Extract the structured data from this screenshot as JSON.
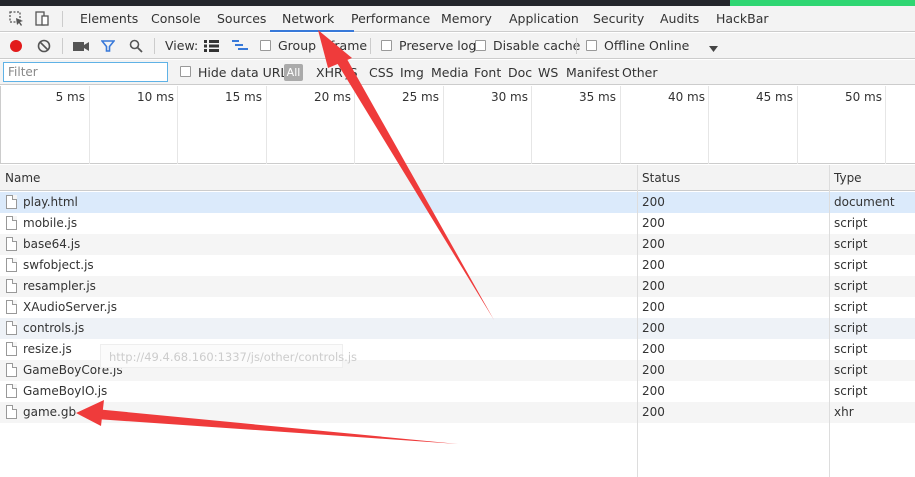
{
  "devtools": {
    "tabs": [
      {
        "label": "Elements"
      },
      {
        "label": "Console"
      },
      {
        "label": "Sources"
      },
      {
        "label": "Network"
      },
      {
        "label": "Performance"
      },
      {
        "label": "Memory"
      },
      {
        "label": "Application"
      },
      {
        "label": "Security"
      },
      {
        "label": "Audits"
      },
      {
        "label": "HackBar"
      }
    ],
    "active_tab": "Network",
    "toolbar": {
      "view_label": "View:",
      "group_label": "Group",
      "frame_label": "frame",
      "preserve_log_label": "Preserve log",
      "disable_cache_label": "Disable cache",
      "offline_label": "Offline",
      "throttle_value": "Online"
    },
    "filter": {
      "placeholder": "Filter",
      "hide_data_urls_label": "Hide data URLs",
      "types": [
        {
          "label": "All"
        },
        {
          "label": "XHR"
        },
        {
          "label": "JS"
        },
        {
          "label": "CSS"
        },
        {
          "label": "Img"
        },
        {
          "label": "Media"
        },
        {
          "label": "Font"
        },
        {
          "label": "Doc"
        },
        {
          "label": "WS"
        },
        {
          "label": "Manifest"
        },
        {
          "label": "Other"
        }
      ]
    },
    "timeline": {
      "ticks": [
        "5 ms",
        "10 ms",
        "15 ms",
        "20 ms",
        "25 ms",
        "30 ms",
        "35 ms",
        "40 ms",
        "45 ms",
        "50 ms"
      ]
    },
    "table": {
      "headers": {
        "name": "Name",
        "status": "Status",
        "type": "Type"
      },
      "rows": [
        {
          "name": "play.html",
          "status": "200",
          "type": "document"
        },
        {
          "name": "mobile.js",
          "status": "200",
          "type": "script"
        },
        {
          "name": "base64.js",
          "status": "200",
          "type": "script"
        },
        {
          "name": "swfobject.js",
          "status": "200",
          "type": "script"
        },
        {
          "name": "resampler.js",
          "status": "200",
          "type": "script"
        },
        {
          "name": "XAudioServer.js",
          "status": "200",
          "type": "script"
        },
        {
          "name": "controls.js",
          "status": "200",
          "type": "script"
        },
        {
          "name": "resize.js",
          "status": "200",
          "type": "script"
        },
        {
          "name": "GameBoyCore.js",
          "status": "200",
          "type": "script"
        },
        {
          "name": "GameBoyIO.js",
          "status": "200",
          "type": "script"
        },
        {
          "name": "game.gb",
          "status": "200",
          "type": "xhr"
        }
      ]
    },
    "tooltip": "http://49.4.68.160:1337/js/other/controls.js"
  },
  "colors": {
    "accent": "#3879d9",
    "record": "#e21a1a",
    "annotation_arrow": "#ef3b3b"
  }
}
